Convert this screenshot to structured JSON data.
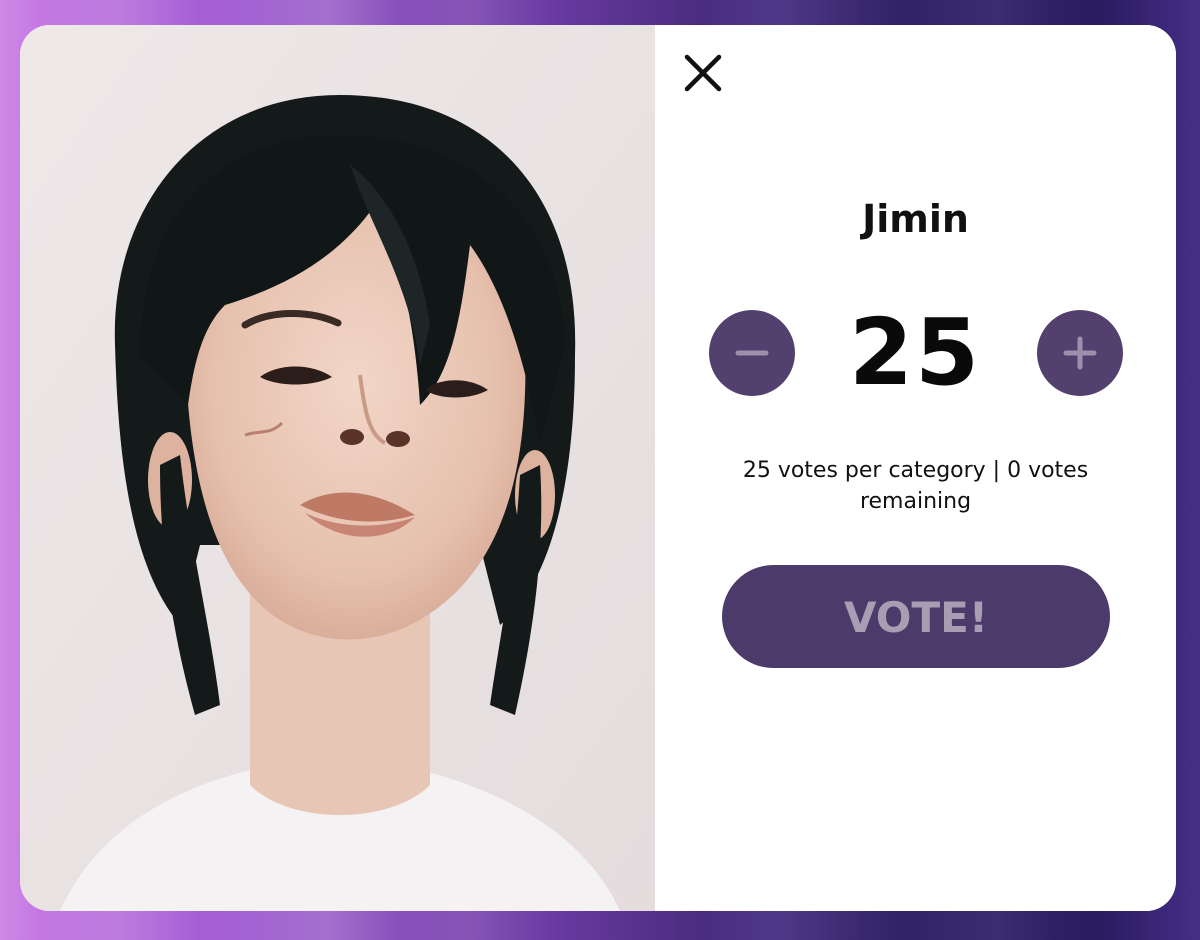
{
  "modal": {
    "close_icon": "close-icon",
    "artist_name": "Jimin",
    "vote_count": "25",
    "minus_icon": "minus-icon",
    "plus_icon": "plus-icon",
    "votes_info": "25 votes per category | 0 votes remaining",
    "vote_label": "VOTE!"
  },
  "colors": {
    "accent": "#53406f",
    "vote_button": "#4c3a6a",
    "vote_label": "#a89eb3",
    "background_left": "#c97be3",
    "background_right": "#2a1b63"
  }
}
